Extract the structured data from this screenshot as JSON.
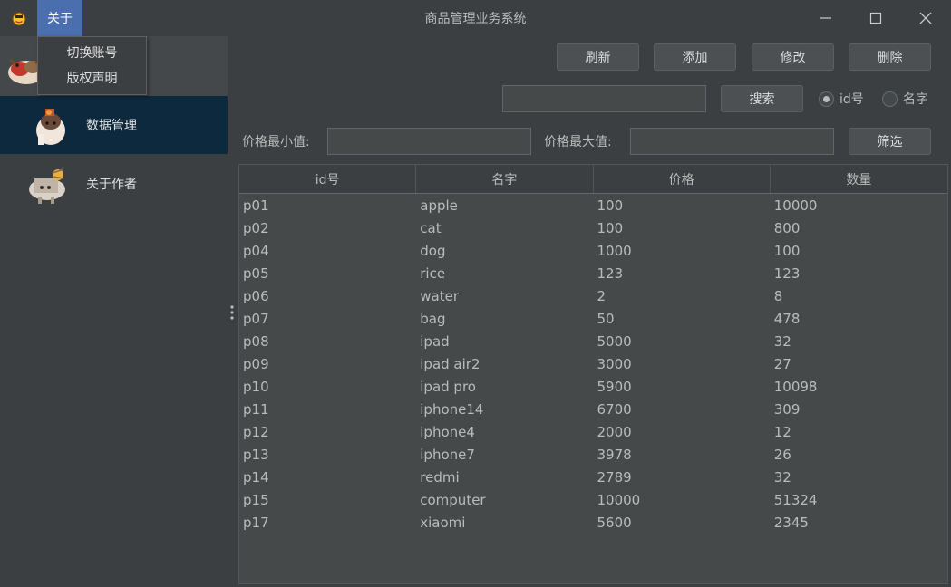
{
  "window": {
    "title": "商品管理业务系统",
    "menu_about": "关于"
  },
  "dropdown": {
    "items": [
      "切换账号",
      "版权声明"
    ]
  },
  "sidebar": {
    "items": [
      {
        "label": "数据管理",
        "active": true
      },
      {
        "label": "关于作者",
        "active": false
      }
    ]
  },
  "toolbar": {
    "refresh": "刷新",
    "add": "添加",
    "edit": "修改",
    "delete": "删除",
    "search": "搜索",
    "filter": "筛选"
  },
  "search": {
    "value": "",
    "radio_id": "id号",
    "radio_name": "名字",
    "selected": "id号"
  },
  "filter": {
    "min_label": "价格最小值:",
    "max_label": "价格最大值:",
    "min_value": "",
    "max_value": ""
  },
  "table": {
    "columns": [
      "id号",
      "名字",
      "价格",
      "数量"
    ],
    "rows": [
      [
        "p01",
        "apple",
        "100",
        "10000"
      ],
      [
        "p02",
        "cat",
        "100",
        "800"
      ],
      [
        "p04",
        "dog",
        "1000",
        "100"
      ],
      [
        "p05",
        "rice",
        "123",
        "123"
      ],
      [
        "p06",
        "water",
        "2",
        "8"
      ],
      [
        "p07",
        "bag",
        "50",
        "478"
      ],
      [
        "p08",
        "ipad",
        "5000",
        "32"
      ],
      [
        "p09",
        "ipad air2",
        "3000",
        "27"
      ],
      [
        "p10",
        "ipad pro",
        "5900",
        "10098"
      ],
      [
        "p11",
        "iphone14",
        "6700",
        "309"
      ],
      [
        "p12",
        "iphone4",
        "2000",
        "12"
      ],
      [
        "p13",
        "iphone7",
        "3978",
        "26"
      ],
      [
        "p14",
        "redmi",
        "2789",
        "32"
      ],
      [
        "p15",
        "computer",
        "10000",
        "51324"
      ],
      [
        "p17",
        "xiaomi",
        "5600",
        "2345"
      ]
    ]
  },
  "colors": {
    "background": "#3c3f41",
    "menu_active": "#4b6eaf",
    "sidebar_active": "#0d293e",
    "table_bg": "#45494a"
  }
}
